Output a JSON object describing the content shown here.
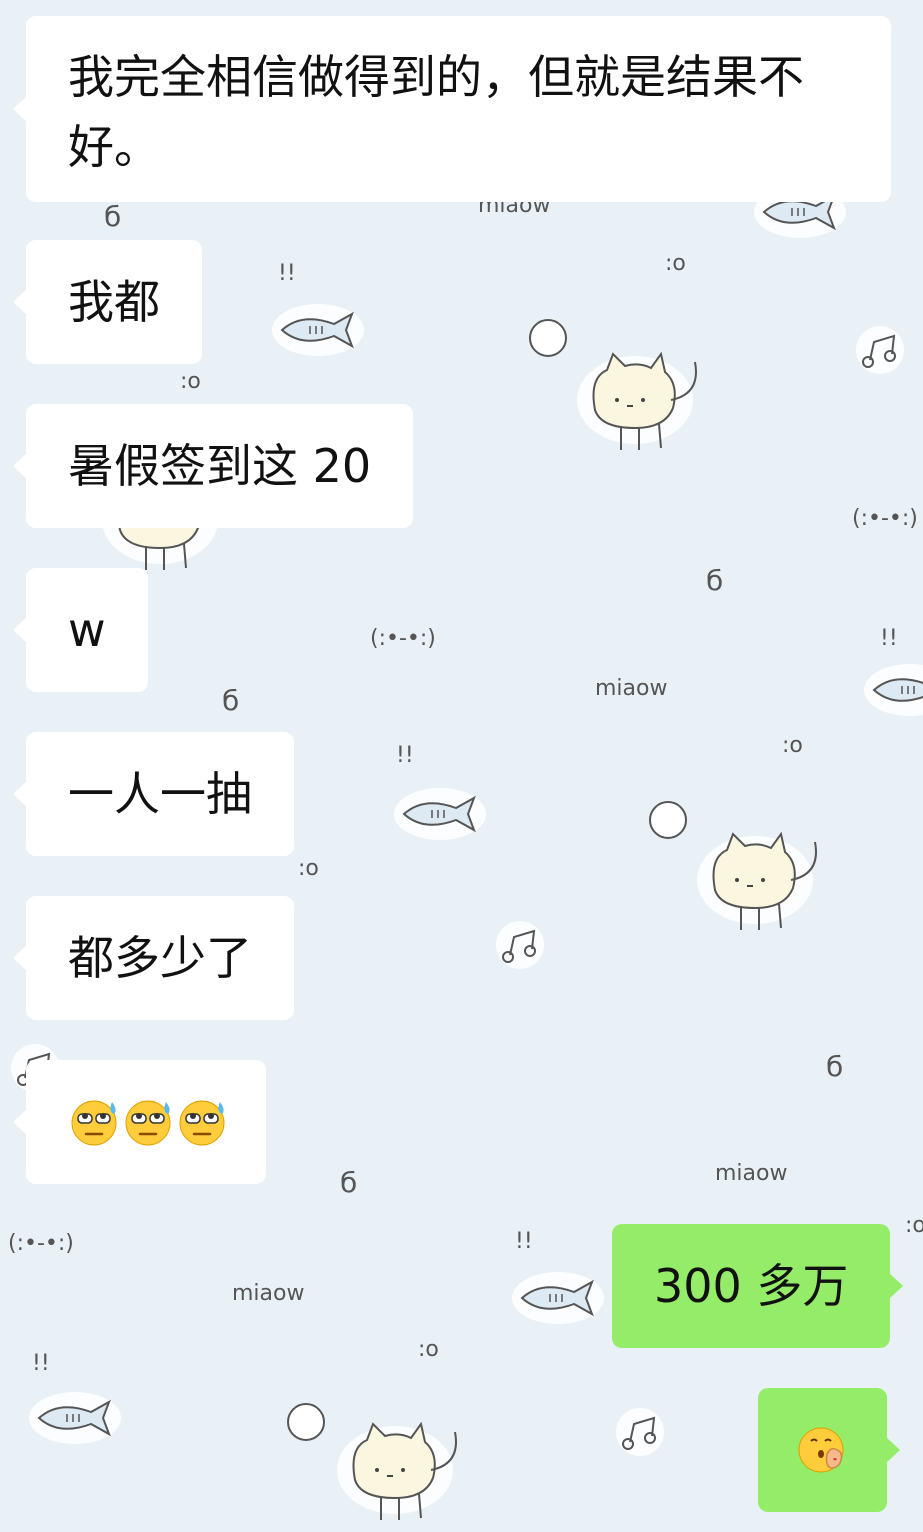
{
  "chat": {
    "messages": [
      {
        "side": "in",
        "text": "我完全相信做得到的，但就是结果不好。"
      },
      {
        "side": "in",
        "text": "我都"
      },
      {
        "side": "in",
        "text": "暑假签到这 20"
      },
      {
        "side": "in",
        "text": "w"
      },
      {
        "side": "in",
        "text": "一人一抽"
      },
      {
        "side": "in",
        "text": "都多少了"
      },
      {
        "side": "in",
        "emoji": [
          "cold-sweat-eye-roll-emoji",
          "cold-sweat-eye-roll-emoji",
          "cold-sweat-eye-roll-emoji"
        ]
      },
      {
        "side": "out",
        "text": "300 多万"
      },
      {
        "side": "out",
        "emoji": [
          "blowing-kiss-hand-emoji"
        ]
      }
    ]
  },
  "wallpaper": {
    "pattern": "cat-and-fish-doodles",
    "doodle_texts": [
      "miaow",
      "!!",
      ":o",
      "б",
      "(:•-•:)"
    ]
  },
  "colors": {
    "background": "#e9f1f6",
    "incoming_bubble": "#ffffff",
    "outgoing_bubble": "#95ec69",
    "text": "#111111"
  }
}
